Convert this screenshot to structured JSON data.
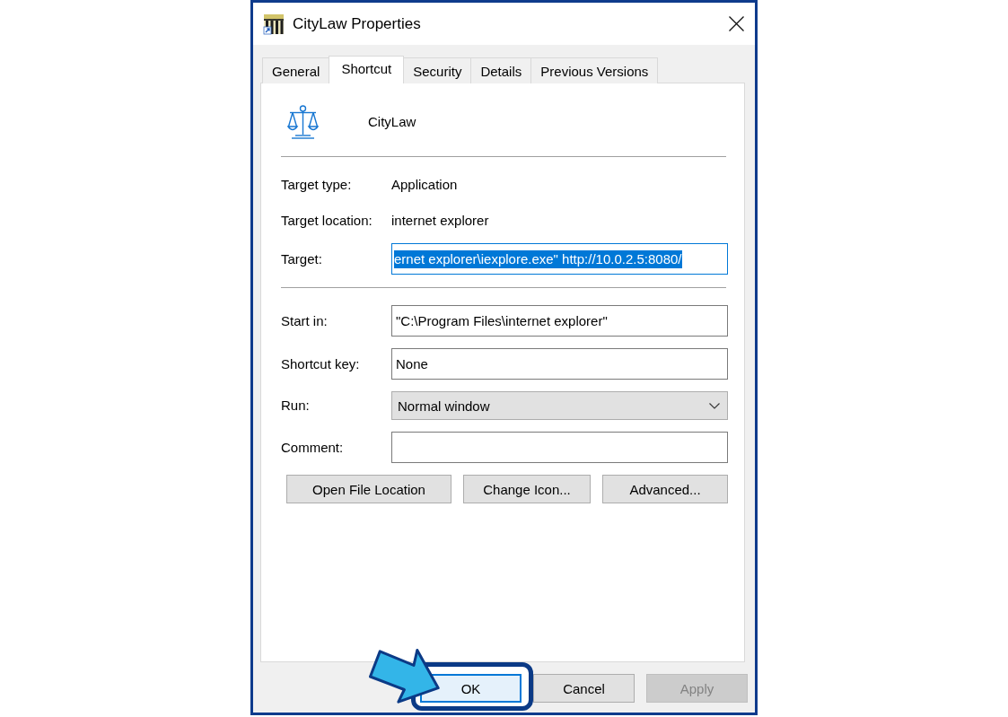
{
  "window": {
    "title": "CityLaw Properties"
  },
  "tabs": [
    {
      "label": "General",
      "selected": false
    },
    {
      "label": "Shortcut",
      "selected": true
    },
    {
      "label": "Security",
      "selected": false
    },
    {
      "label": "Details",
      "selected": false
    },
    {
      "label": "Previous Versions",
      "selected": false
    }
  ],
  "shortcut": {
    "name": "CityLaw"
  },
  "target": [
    {
      "kind": "info",
      "label": "Target type:",
      "value": "Application"
    },
    {
      "kind": "info",
      "label": "Target location:",
      "value": "internet explorer"
    },
    {
      "kind": "text",
      "label": "Target:",
      "value": "ernet explorer\\iexplore.exe\" http://10.0.2.5:8080/",
      "text_selected": true
    }
  ],
  "options": [
    {
      "kind": "text",
      "label": "Start in:",
      "value": "\"C:\\Program Files\\internet explorer\"",
      "text_selected": false
    },
    {
      "kind": "text",
      "label": "Shortcut key:",
      "value": "None",
      "text_selected": false
    },
    {
      "kind": "dropdown",
      "label": "Run:",
      "value": "Normal window"
    },
    {
      "kind": "text",
      "label": "Comment:",
      "text_selected": false
    }
  ],
  "actions": [
    {
      "label": "Open File Location"
    },
    {
      "label": "Change Icon..."
    },
    {
      "label": "Advanced..."
    }
  ],
  "footer_buttons": [
    {
      "label": "OK",
      "default": true,
      "disabled": false,
      "callout": true
    },
    {
      "label": "Cancel",
      "default": false,
      "disabled": false,
      "callout": false
    },
    {
      "label": "Apply",
      "default": false,
      "disabled": true,
      "callout": false
    }
  ]
}
